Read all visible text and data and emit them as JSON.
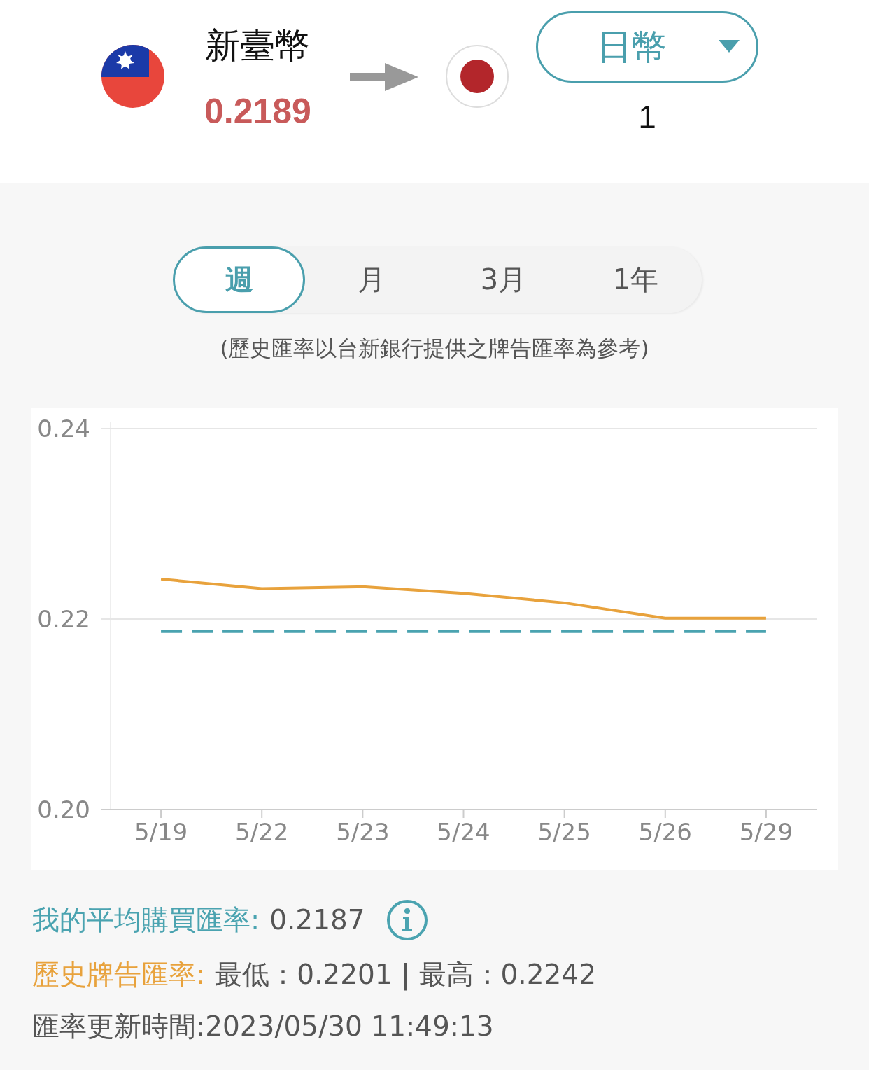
{
  "header": {
    "from_currency": {
      "name": "新臺幣",
      "rate": "0.2189"
    },
    "to_currency": {
      "name": "日幣",
      "amount": "1"
    }
  },
  "period_tabs": [
    {
      "label": "週",
      "selected": true
    },
    {
      "label": "月",
      "selected": false
    },
    {
      "label": "3月",
      "selected": false
    },
    {
      "label": "1年",
      "selected": false
    }
  ],
  "note": "(歷史匯率以台新銀行提供之牌告匯率為參考)",
  "chart": {
    "chart_data": {
      "type": "line",
      "categories": [
        "5/19",
        "5/22",
        "5/23",
        "5/24",
        "5/25",
        "5/26",
        "5/29"
      ],
      "ylim": [
        0.2,
        0.24
      ],
      "yticks": [
        {
          "value": 0.2,
          "label": "0.20"
        },
        {
          "value": 0.22,
          "label": "0.22"
        },
        {
          "value": 0.24,
          "label": "0.24"
        }
      ],
      "series": [
        {
          "color": "#e8a23c",
          "line_style": "solid",
          "values": [
            0.2242,
            0.2232,
            0.2234,
            0.2227,
            0.2217,
            0.2201,
            0.2201
          ]
        },
        {
          "color": "#4aa3b0",
          "line_style": "dashed",
          "values": [
            0.2187,
            0.2187,
            0.2187,
            0.2187,
            0.2187,
            0.2187,
            0.2187
          ]
        }
      ]
    }
  },
  "summary": {
    "average_label": "我的平均購買匯率:",
    "average_value": "0.2187",
    "history_label": "歷史牌告匯率:",
    "history_value": "最低：0.2201 | 最高：0.2242",
    "updated": "匯率更新時間:2023/05/30 11:49:13"
  }
}
